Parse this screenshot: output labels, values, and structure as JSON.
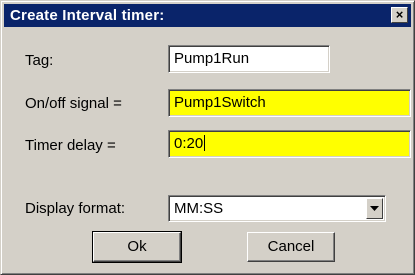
{
  "window": {
    "title": "Create Interval timer:",
    "close_glyph": "×"
  },
  "form": {
    "tag_label": "Tag:",
    "tag_value": "Pump1Run",
    "onoff_label": "On/off signal =",
    "onoff_value": "Pump1Switch",
    "delay_label": "Timer delay =",
    "delay_value": "0:20",
    "format_label": "Display format:",
    "format_value": "MM:SS"
  },
  "buttons": {
    "ok_label": "Ok",
    "cancel_label": "Cancel"
  },
  "colors": {
    "titlebar": "#0a246a",
    "dialog_bg": "#d4d0c8",
    "highlight_field": "#ffff00"
  }
}
